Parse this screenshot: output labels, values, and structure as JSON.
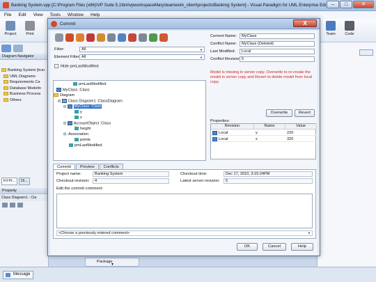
{
  "app": {
    "title": "Banking System.vpp [C:\\Program Files (x86)\\VP Suite 5.1\\bin\\vpworkspaceMary\\teamwork_client\\projects\\Banking System] - Visual Paradigm for UML Enterprise Edi...",
    "menu": [
      "File",
      "Edit",
      "View",
      "Tools",
      "Window",
      "Help"
    ],
    "toolbar": {
      "project": "Project",
      "print": "Print",
      "team": "Team",
      "code": "Code"
    },
    "left_panel": {
      "title": "Diagram Navigator",
      "tree": [
        "Banking System [trun",
        "UML Diagrams",
        "Requirements Ca",
        "Database Modelin",
        "Business Process",
        "Others"
      ],
      "property_tab1": "Fil Pr...",
      "property_tab2": "Di...",
      "property_title": "Property",
      "property_sub": "Class Diagram1 - Cla"
    },
    "bottom_right": {
      "package": "Package"
    },
    "status": {
      "message_button": "Message"
    },
    "colors": {
      "accent": "#2e6fd1",
      "warning": "#d42020"
    }
  },
  "dialog": {
    "title": "Commit",
    "close_label": "X",
    "filter_label": "Filter:",
    "filter_value": "All",
    "element_filter_label": "Element Filter:",
    "element_filter_value": "All",
    "hide_label": "Hide pmLastModified",
    "tree": {
      "n1": "pmLastModified",
      "n2": "MyClass :Class",
      "n3": "Diagram",
      "n4": "Class Diagram1 :ClassDiagram",
      "n5": "MyClass :Class",
      "n6": "y",
      "n7": "x",
      "n8": "AccountObject :Class",
      "n9": "height",
      "n10": ":Association",
      "n11": "points",
      "n12": "pmLastModified"
    },
    "info": {
      "current_name_label": "Current Name:",
      "current_name_value": "MyClass",
      "conflict_name_label": "Conflict Name:",
      "conflict_name_value": "MyClass (Deleted)",
      "last_modified_label": "Last Modified:",
      "last_modified_value": "Local",
      "conflict_revision_label": "Conflict Revision:",
      "conflict_revision_value": "5",
      "warning": "Model is missing in server copy. Overwrite to re-create the model in server copy and Revert to delete model from local copy.",
      "overwrite_button": "Overwrite",
      "revert_button": "Revert"
    },
    "properties": {
      "title": "Properties:",
      "headers": [
        "Revision",
        "Name",
        "Value"
      ],
      "rows": [
        {
          "revision": "Local",
          "name": "y",
          "value": "220"
        },
        {
          "revision": "Local",
          "name": "x",
          "value": "320"
        }
      ]
    },
    "tabs": [
      "Commit",
      "Preview",
      "Conflicts"
    ],
    "commit": {
      "project_name_label": "Project name:",
      "project_name_value": "Banking System",
      "checkout_revision_label": "Checkout revision:",
      "checkout_revision_value": "4",
      "checkout_time_label": "Checkout time:",
      "checkout_time_value": "Dec 17, 2010, 3:15:24PM",
      "latest_revision_label": "Latest server revision:",
      "latest_revision_value": "5",
      "comment_label": "Edit the commit comment:",
      "previous_comment": "<Choose a previously entered comment>"
    },
    "buttons": {
      "ok": "OK",
      "cancel": "Cancel",
      "help": "Help"
    }
  }
}
